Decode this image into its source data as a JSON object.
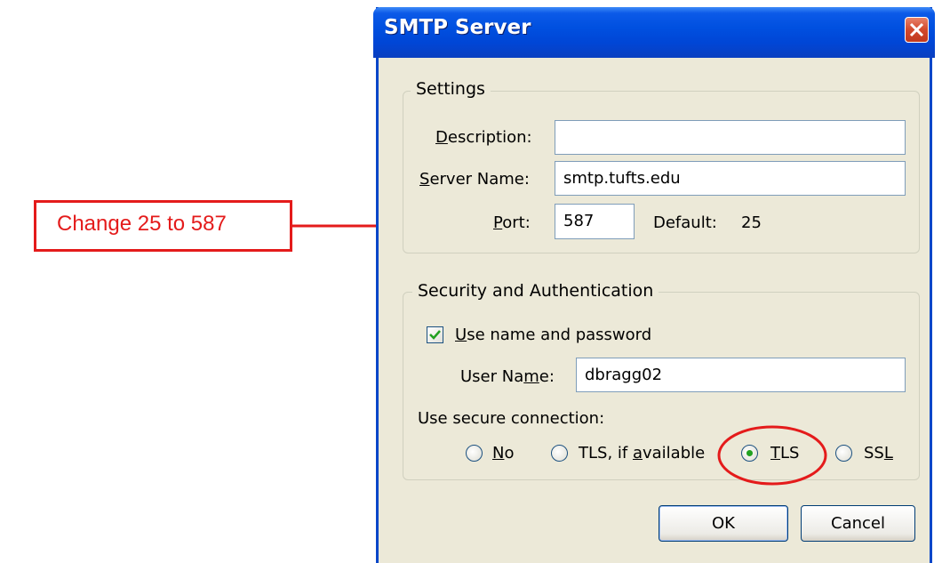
{
  "window": {
    "title": "SMTP Server",
    "close_icon": "close-icon"
  },
  "settings": {
    "legend": "Settings",
    "description_label_pre": "",
    "description_label_key": "D",
    "description_label_post": "escription:",
    "description_value": "",
    "server_label_key": "S",
    "server_label_post": "erver Name:",
    "server_value": "smtp.tufts.edu",
    "port_label_key": "P",
    "port_label_post": "ort:",
    "port_value": "587",
    "default_label": "Default:",
    "default_value": "25"
  },
  "security": {
    "legend": "Security and Authentication",
    "use_name_key": "U",
    "use_name_post": "se name and password",
    "use_name_checked": true,
    "username_label_pre": "User Na",
    "username_label_key": "m",
    "username_label_post": "e:",
    "username_value": "dbragg02",
    "secure_label": "Use secure connection:",
    "options": [
      {
        "pre": "",
        "key": "N",
        "post": "o",
        "selected": false
      },
      {
        "pre": "TLS, if ",
        "key": "a",
        "post": "vailable",
        "selected": false
      },
      {
        "pre": "",
        "key": "T",
        "post": "LS",
        "selected": true
      },
      {
        "pre": "SS",
        "key": "L",
        "post": "",
        "selected": false
      }
    ]
  },
  "buttons": {
    "ok": "OK",
    "cancel": "Cancel"
  },
  "annotation": {
    "text": "Change 25 to 587",
    "color": "#e41b1b"
  },
  "colors": {
    "title_bar": "#0050e0",
    "dialog_bg": "#ece9d8",
    "annotation": "#e41b1b",
    "selected_radio": "#21a121"
  }
}
